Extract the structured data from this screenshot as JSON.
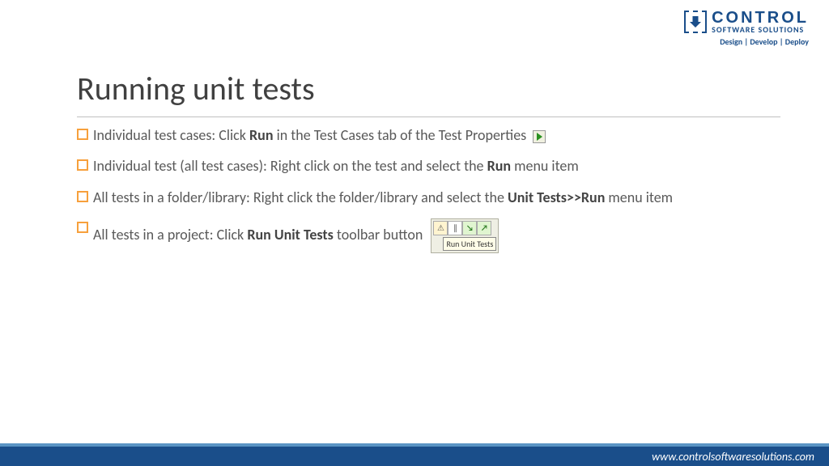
{
  "logo": {
    "line1": "CONTROL",
    "line2": "SOFTWARE SOLUTIONS",
    "tagline": "Design | Develop | Deploy"
  },
  "title": "Running unit tests",
  "bullets": {
    "b1_pre": "Individual test cases: Click ",
    "b1_bold": "Run",
    "b1_post": " in the Test Cases tab of the Test Properties",
    "b2_pre": "Individual test (all test cases): Right click on the test and select the ",
    "b2_bold": "Run",
    "b2_post": " menu item",
    "b3_pre": "All tests in a folder/library: Right click the folder/library and select the ",
    "b3_bold": "Unit Tests>>Run",
    "b3_post": " menu item",
    "b4_pre": "All tests in a project: Click ",
    "b4_bold": "Run Unit Tests",
    "b4_post": " toolbar button"
  },
  "toolbar_tooltip": "Run Unit Tests",
  "footer_url": "www.controlsoftwaresolutions.com"
}
